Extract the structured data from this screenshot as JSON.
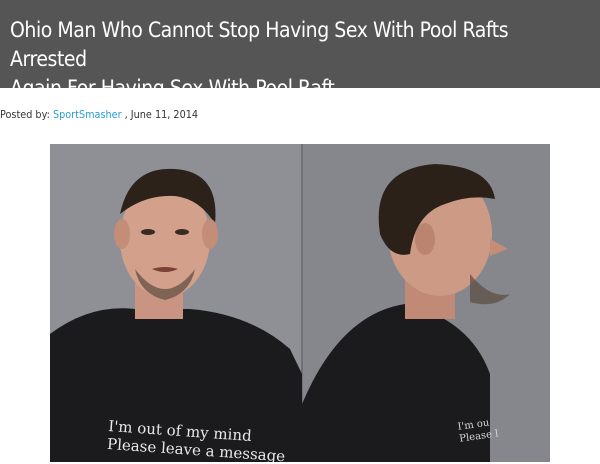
{
  "article": {
    "title_line1": "Ohio Man Who Cannot Stop Having Sex With Pool Rafts Arrested",
    "title_line2": "Again For Having Sex With Pool Raft",
    "posted_by_label": "Posted by:",
    "author": "SportSmasher",
    "date": ", June 11, 2014"
  },
  "photo": {
    "shirt_line1": "I'm out of my mind",
    "shirt_line2": "Please leave a message",
    "side_shirt_line1": "I'm ou",
    "side_shirt_line2": "Please l"
  },
  "colors": {
    "header_bg": "#555555",
    "link": "#2a9fd6"
  }
}
